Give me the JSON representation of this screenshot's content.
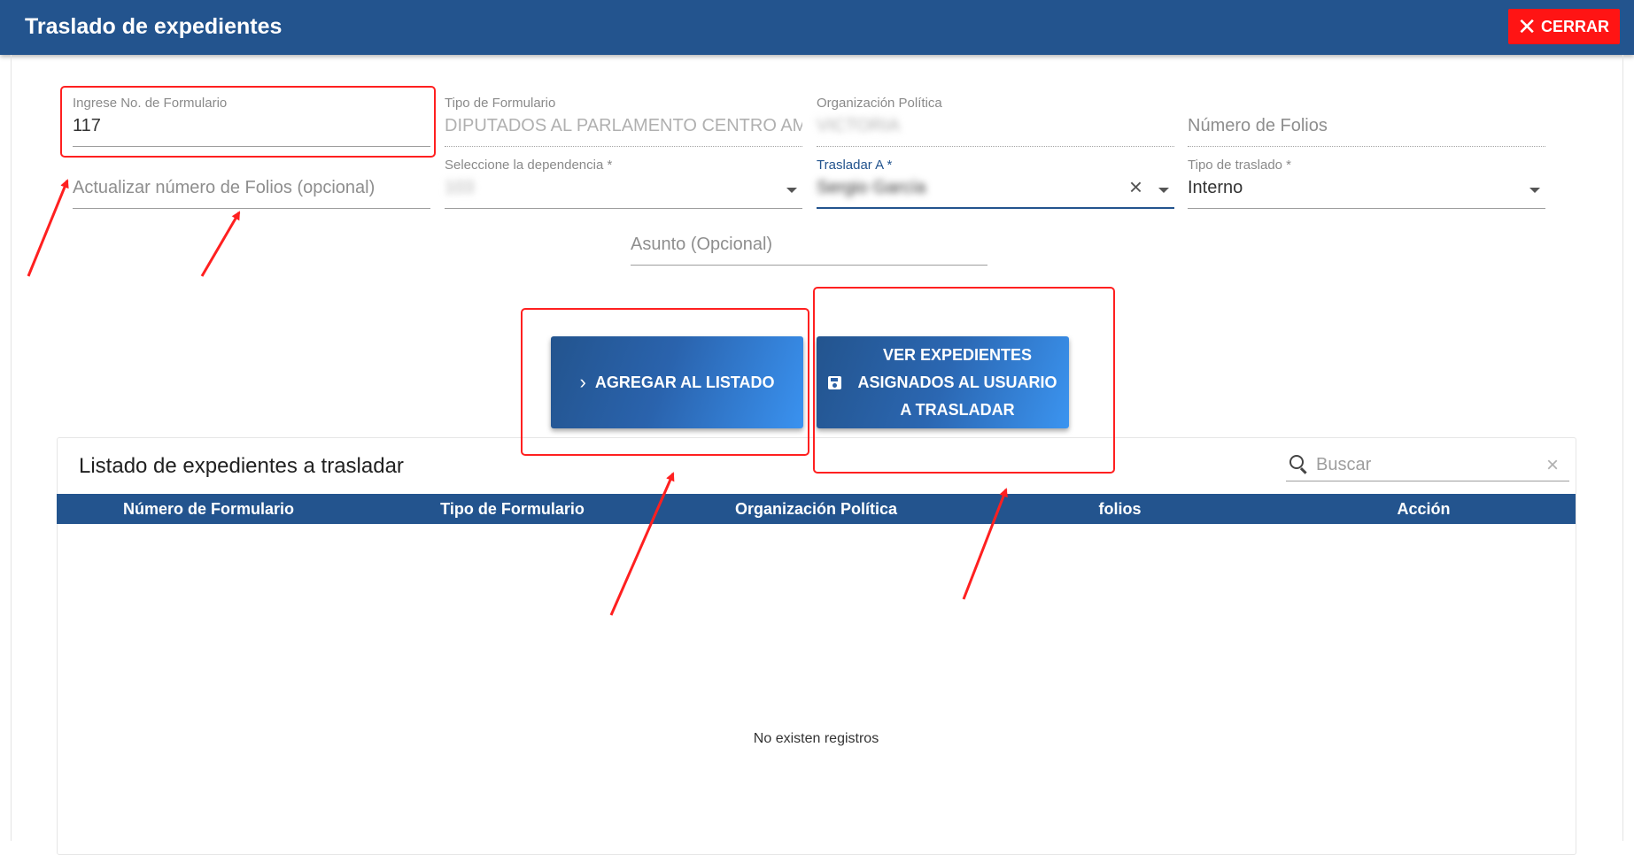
{
  "header": {
    "title": "Traslado de expedientes",
    "close_label": "CERRAR"
  },
  "form": {
    "formulario": {
      "label": "Ingrese No. de Formulario",
      "value": "117"
    },
    "tipo": {
      "label": "Tipo de Formulario",
      "value": "DIPUTADOS AL PARLAMENTO CENTRO AME"
    },
    "organizacion": {
      "label": "Organización Política",
      "value": "VICTORIA"
    },
    "num_folios": {
      "placeholder": "Número de Folios"
    },
    "actualizar_folios": {
      "placeholder": "Actualizar número de Folios (opcional)"
    },
    "dependencia": {
      "label": "Seleccione la dependencia *",
      "value": "103"
    },
    "trasladar_a": {
      "label": "Trasladar A *",
      "value": "Sergio García"
    },
    "tipo_traslado": {
      "label": "Tipo de traslado *",
      "value": "Interno"
    },
    "asunto": {
      "placeholder": "Asunto (Opcional)"
    }
  },
  "buttons": {
    "add": "AGREGAR AL LISTADO",
    "view_line1": "VER EXPEDIENTES",
    "view_line2": "ASIGNADOS AL USUARIO",
    "view_line3": "A TRASLADAR"
  },
  "table": {
    "title": "Listado de expedientes a trasladar",
    "search_placeholder": "Buscar",
    "columns": [
      "Número de Formulario",
      "Tipo de Formulario",
      "Organización Política",
      "folios",
      "Acción"
    ],
    "empty": "No existen registros"
  },
  "colors": {
    "primary": "#23548e",
    "close": "#ff1414",
    "annotation": "#ff2020"
  }
}
